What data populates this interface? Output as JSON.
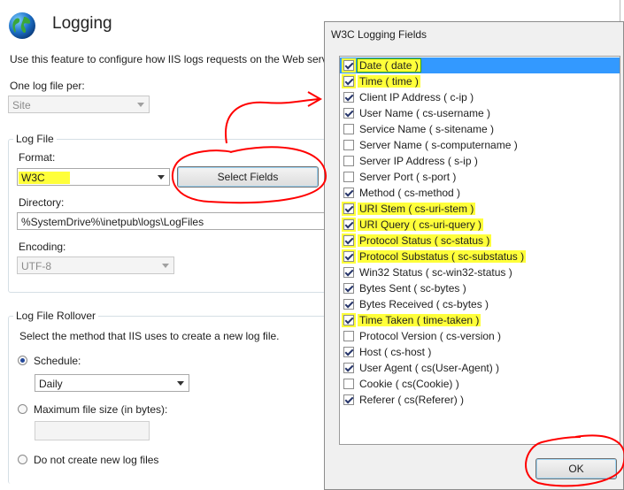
{
  "colors": {
    "highlight": "#ffff3a",
    "selection": "#3399ff",
    "annotation": "#ff0000"
  },
  "page": {
    "title": "Logging",
    "description": "Use this feature to configure how IIS logs requests on the Web serve",
    "one_log_file_label": "One log file per:",
    "one_log_file_value": "Site",
    "log_file": {
      "group_label": "Log File",
      "format_label": "Format:",
      "format_value": "W3C",
      "select_fields_label": "Select Fields",
      "directory_label": "Directory:",
      "directory_value": "%SystemDrive%\\inetpub\\logs\\LogFiles",
      "encoding_label": "Encoding:",
      "encoding_value": "UTF-8"
    },
    "rollover": {
      "group_label": "Log File Rollover",
      "description": "Select the method that IIS uses to create a new log file.",
      "schedule_label": "Schedule:",
      "schedule_value": "Daily",
      "max_size_label": "Maximum file size (in bytes):",
      "no_new_label": "Do not create new log files"
    }
  },
  "dialog": {
    "title": "W3C Logging Fields",
    "ok_label": "OK",
    "fields": [
      {
        "label": "Date ( date )",
        "checked": true,
        "highlighted": true,
        "selected": true
      },
      {
        "label": "Time ( time )",
        "checked": true,
        "highlighted": true
      },
      {
        "label": "Client IP Address ( c-ip )",
        "checked": true
      },
      {
        "label": "User Name ( cs-username )",
        "checked": true
      },
      {
        "label": "Service Name ( s-sitename )",
        "checked": false
      },
      {
        "label": "Server Name ( s-computername )",
        "checked": false
      },
      {
        "label": "Server IP Address ( s-ip )",
        "checked": false
      },
      {
        "label": "Server Port ( s-port )",
        "checked": false
      },
      {
        "label": "Method ( cs-method )",
        "checked": true
      },
      {
        "label": "URI Stem ( cs-uri-stem )",
        "checked": true,
        "highlighted": true
      },
      {
        "label": "URI Query ( cs-uri-query )",
        "checked": true,
        "highlighted": true
      },
      {
        "label": "Protocol Status ( sc-status )",
        "checked": true,
        "highlighted": true
      },
      {
        "label": "Protocol Substatus ( sc-substatus )",
        "checked": true,
        "highlighted": true
      },
      {
        "label": "Win32 Status ( sc-win32-status )",
        "checked": true
      },
      {
        "label": "Bytes Sent ( sc-bytes )",
        "checked": true
      },
      {
        "label": "Bytes Received ( cs-bytes )",
        "checked": true
      },
      {
        "label": "Time Taken ( time-taken )",
        "checked": true,
        "highlighted": true
      },
      {
        "label": "Protocol Version ( cs-version )",
        "checked": false
      },
      {
        "label": "Host ( cs-host )",
        "checked": true
      },
      {
        "label": "User Agent ( cs(User-Agent) )",
        "checked": true
      },
      {
        "label": "Cookie ( cs(Cookie) )",
        "checked": false
      },
      {
        "label": "Referer ( cs(Referer) )",
        "checked": true
      }
    ]
  }
}
